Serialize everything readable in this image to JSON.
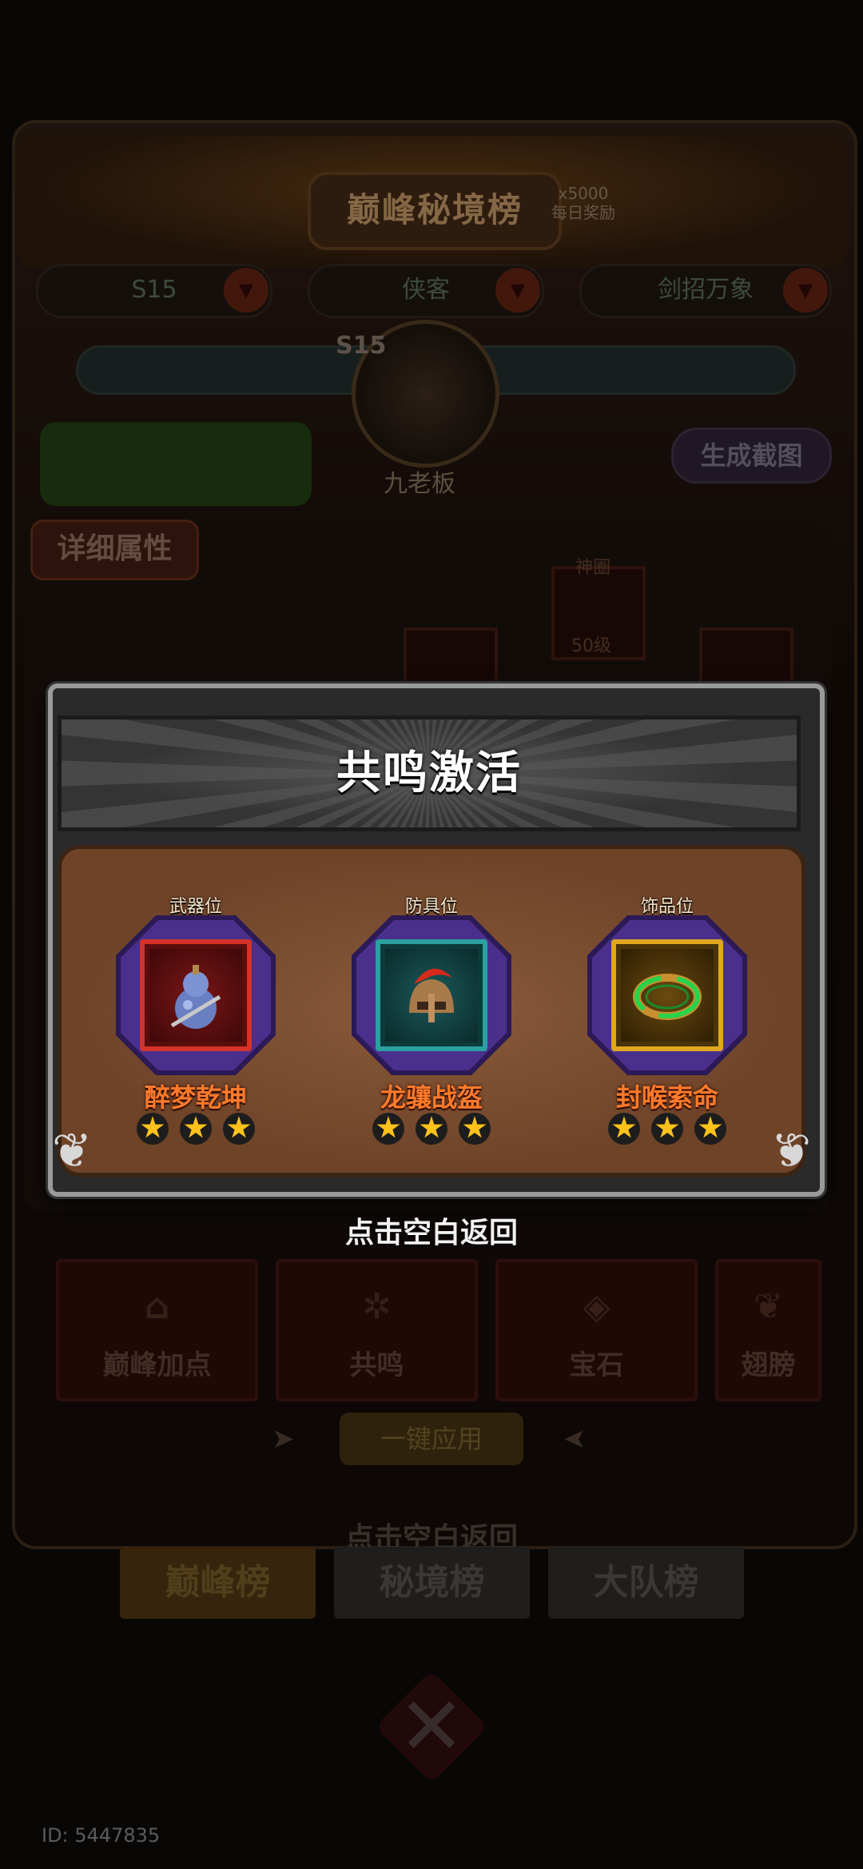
{
  "background": {
    "leaderboard_title": "巅峰秘境榜",
    "reward_amount": "x5000",
    "reward_label": "每日奖励",
    "dropdowns": [
      "S15",
      "侠客",
      "剑招万象"
    ],
    "season_badge": "S15",
    "player_name": "九老板",
    "screenshot_button": "生成截图",
    "detail_attr_button": "详细属性",
    "equip_level_label": "神圈",
    "equip_level": "50级",
    "categories": [
      "巅峰加点",
      "共鸣",
      "宝石",
      "翅膀"
    ],
    "apply_button": "一键应用",
    "return_hint": "点击空白返回",
    "tabs": [
      "巅峰榜",
      "秘境榜",
      "大队榜"
    ],
    "uid": "ID: 5447835"
  },
  "modal": {
    "title": "共鸣激活",
    "slots": [
      {
        "position": "武器位",
        "name": "醉梦乾坤",
        "stars": 3,
        "icon": "gourd-icon",
        "frame_color": "#c0281c"
      },
      {
        "position": "防具位",
        "name": "龙骧战盔",
        "stars": 3,
        "icon": "helmet-icon",
        "frame_color": "#2b8f8f"
      },
      {
        "position": "饰品位",
        "name": "封喉索命",
        "stars": 3,
        "icon": "jade-ring-icon",
        "frame_color": "#d9a21c"
      }
    ],
    "return_hint": "点击空白返回"
  }
}
